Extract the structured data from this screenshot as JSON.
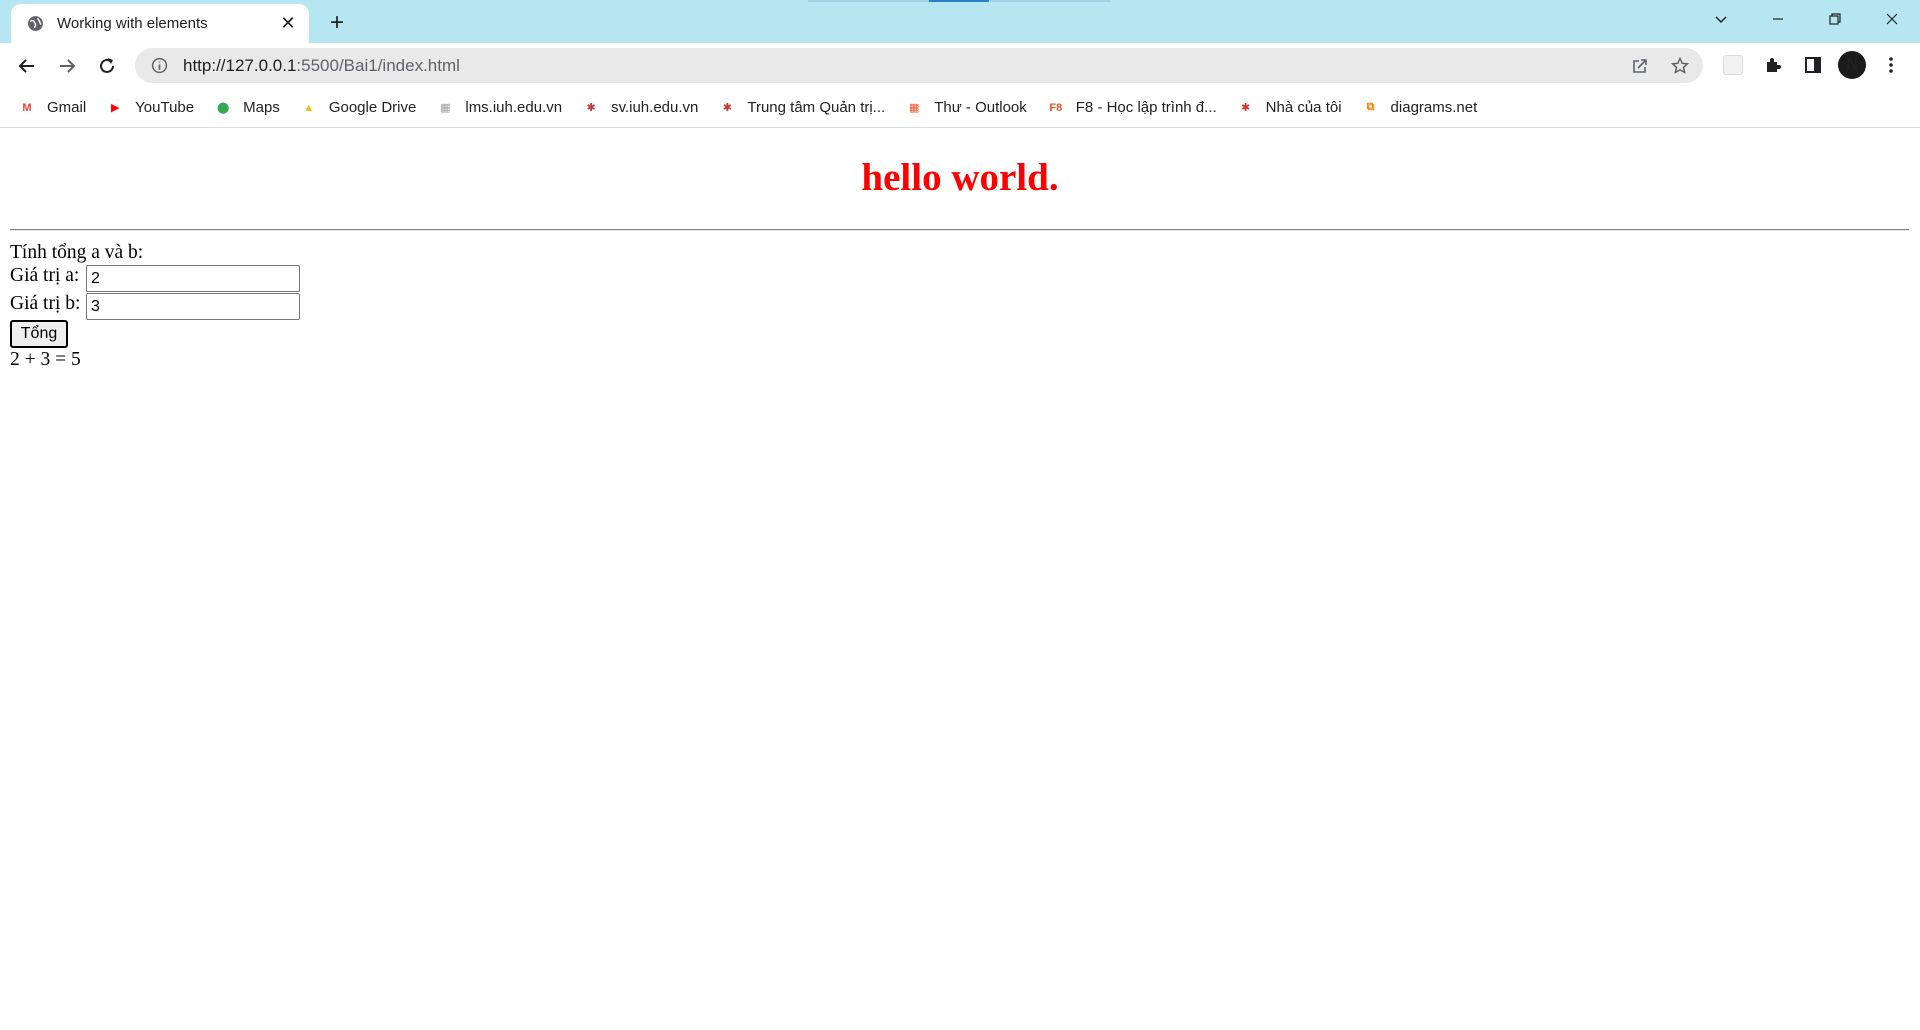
{
  "browser": {
    "tab": {
      "title": "Working with elements",
      "close": "✕"
    },
    "new_tab": "+",
    "url_host": "http://127.0.0.1",
    "url_rest": ":5500/Bai1/index.html",
    "bookmarks": [
      {
        "label": "Gmail",
        "icon": "gmail-icon",
        "color": "#ea4335",
        "glyph": "M"
      },
      {
        "label": "YouTube",
        "icon": "youtube-icon",
        "color": "#ff0000",
        "glyph": "▶"
      },
      {
        "label": "Maps",
        "icon": "maps-icon",
        "color": "#34a853",
        "glyph": "⬤"
      },
      {
        "label": "Google Drive",
        "icon": "google-drive-icon",
        "color": "#fbbc04",
        "glyph": "▲"
      },
      {
        "label": "lms.iuh.edu.vn",
        "icon": "lms-icon",
        "color": "#9e9e9e",
        "glyph": "▦"
      },
      {
        "label": "sv.iuh.edu.vn",
        "icon": "iuh-icon",
        "color": "#d32f2f",
        "glyph": "✱"
      },
      {
        "label": "Trung tâm Quản trị...",
        "icon": "iuh-center-icon",
        "color": "#d32f2f",
        "glyph": "✱"
      },
      {
        "label": "Thư  - Outlook",
        "icon": "microsoft-icon",
        "color": "#f25022",
        "glyph": "▦"
      },
      {
        "label": "F8 - Học lập trình đ...",
        "icon": "f8-icon",
        "color": "#f05123",
        "glyph": "F8"
      },
      {
        "label": "Nhà của tôi",
        "icon": "iuh-home-icon",
        "color": "#d32f2f",
        "glyph": "✱"
      },
      {
        "label": "diagrams.net",
        "icon": "diagrams-icon",
        "color": "#f08705",
        "glyph": "⧉"
      }
    ]
  },
  "content": {
    "heading": "hello world.",
    "intro": "Tính tổng a và b:",
    "label_a": "Giá trị a:",
    "value_a": "2",
    "label_b": "Giá trị b:",
    "value_b": "3",
    "button": "Tổng",
    "result": "2 + 3 = 5"
  },
  "colors": {
    "tabstrip": "#b7e6f3",
    "heading": "#ff0000"
  }
}
